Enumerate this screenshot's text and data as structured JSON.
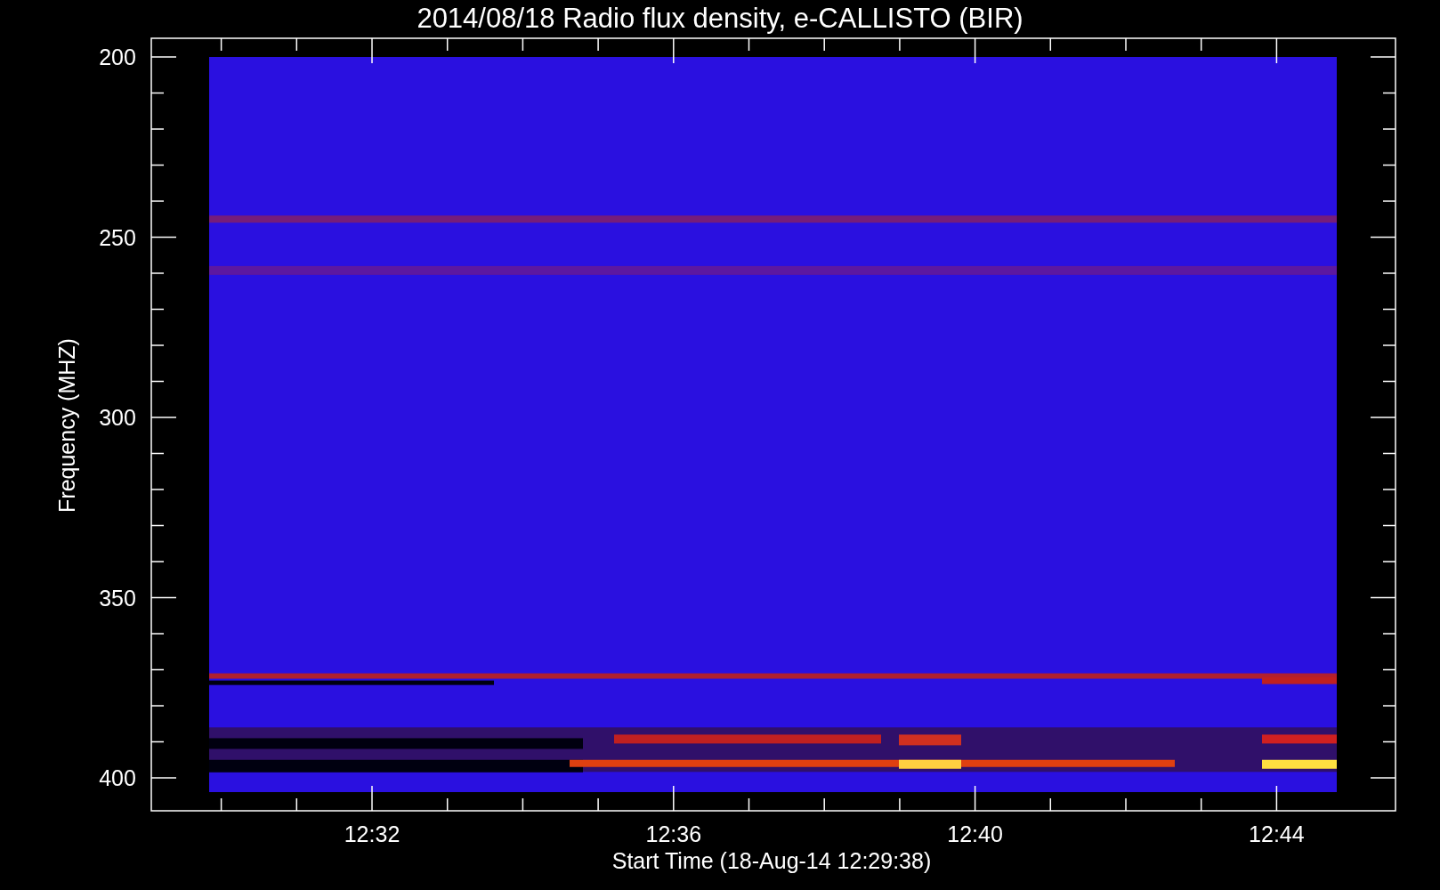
{
  "title": "2014/08/18  Radio flux density, e-CALLISTO (BIR)",
  "y_axis": {
    "label": "Frequency (MHZ)",
    "ticks": [
      "200",
      "250",
      "300",
      "350",
      "400"
    ]
  },
  "x_axis": {
    "label": "Start Time (18-Aug-14 12:29:38)",
    "ticks": [
      "12:32",
      "12:36",
      "12:40",
      "12:44"
    ]
  }
}
